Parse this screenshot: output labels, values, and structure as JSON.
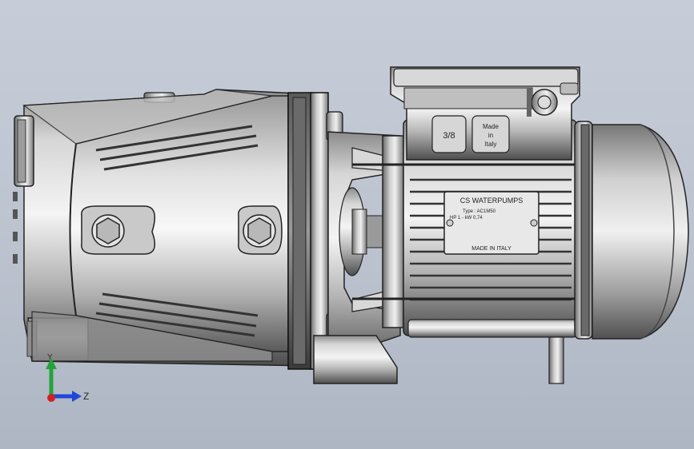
{
  "viewport": {
    "background_top": "#c7cdd8",
    "background_bottom": "#aeb6c3"
  },
  "pump": {
    "flange_size": "3/8",
    "origin_tag": [
      "Made",
      "in",
      "Italy"
    ]
  },
  "nameplate": {
    "brand": "CS WATERPUMPS",
    "type_line": "Type : AC1M50",
    "power_line": "HP 1 - kW 0,74",
    "footer": "MADE IN ITALY"
  },
  "triad": {
    "y_axis": "Y",
    "z_axis": "Z",
    "y_color": "#22a33a",
    "z_color": "#2048d8",
    "x_color": "#d02020"
  }
}
